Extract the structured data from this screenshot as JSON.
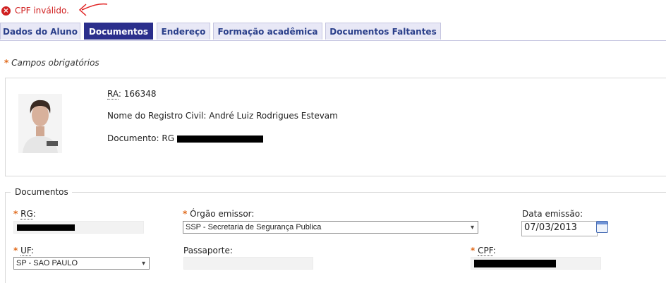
{
  "error": {
    "message": "CPF inválido.",
    "icon": "error-circle-icon",
    "color": "#d02020"
  },
  "tabs": [
    {
      "label": "Dados do Aluno",
      "active": false
    },
    {
      "label": "Documentos",
      "active": true
    },
    {
      "label": "Endereço",
      "active": false
    },
    {
      "label": "Formação acadêmica",
      "active": false
    },
    {
      "label": "Documentos Faltantes",
      "active": false
    }
  ],
  "required_note": {
    "marker": "*",
    "text": "Campos obrigatórios"
  },
  "student": {
    "ra_label": "RA",
    "ra_value": ": 166348",
    "name_label": "Nome do Registro Civil:",
    "name_value": "André Luiz Rodrigues Estevam",
    "doc_label": "Documento:",
    "doc_type": "RG"
  },
  "documents": {
    "legend": "Documentos",
    "rg_label": "RG",
    "orgao_label": "Órgão emissor:",
    "orgao_value": "SSP - Secretaria de Segurança Publica",
    "data_label": "Data emissão:",
    "data_value": "07/03/2013",
    "uf_label": "UF",
    "uf_value": "SP - SAO PAULO",
    "passaporte_label": "Passaporte:",
    "passaporte_value": "",
    "cpf_label": "CPF"
  },
  "colors": {
    "accent": "#2b2f8c",
    "required": "#e06a1b",
    "tab_bg": "#e8e8f6"
  }
}
